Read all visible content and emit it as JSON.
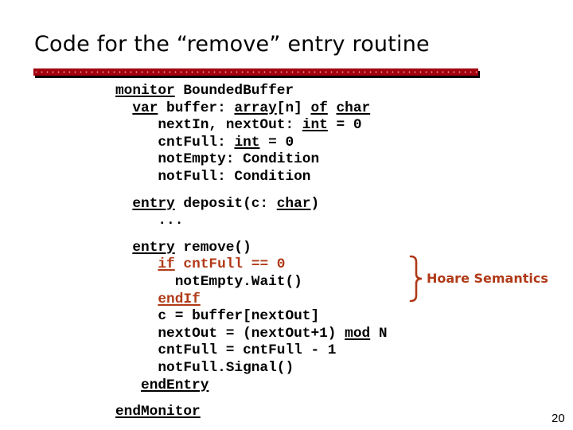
{
  "slide": {
    "title": "Code for the “remove” entry routine",
    "page_number": "20",
    "accent_color": "#a3000f",
    "highlight_color": "#b03a18"
  },
  "code": {
    "lines": [
      {
        "indent": 0,
        "parts": [
          {
            "t": "monitor",
            "kw": true
          },
          {
            "t": " BoundedBuffer"
          }
        ]
      },
      {
        "indent": 2,
        "parts": [
          {
            "t": "var",
            "kw": true
          },
          {
            "t": " buffer: "
          },
          {
            "t": "array",
            "kw": true
          },
          {
            "t": "[n] "
          },
          {
            "t": "of",
            "kw": true
          },
          {
            "t": " "
          },
          {
            "t": "char",
            "kw": true
          }
        ]
      },
      {
        "indent": 5,
        "parts": [
          {
            "t": "nextIn, nextOut: "
          },
          {
            "t": "int",
            "kw": true
          },
          {
            "t": " = 0"
          }
        ]
      },
      {
        "indent": 5,
        "parts": [
          {
            "t": "cntFull: "
          },
          {
            "t": "int",
            "kw": true
          },
          {
            "t": " = 0"
          }
        ]
      },
      {
        "indent": 5,
        "parts": [
          {
            "t": "notEmpty: Condition"
          }
        ]
      },
      {
        "indent": 5,
        "parts": [
          {
            "t": "notFull: Condition"
          }
        ]
      },
      {
        "indent": 2,
        "gap": true,
        "parts": [
          {
            "t": "entry",
            "kw": true
          },
          {
            "t": " deposit(c: "
          },
          {
            "t": "char",
            "kw": true
          },
          {
            "t": ")"
          }
        ]
      },
      {
        "indent": 5,
        "parts": [
          {
            "t": "..."
          }
        ]
      },
      {
        "indent": 2,
        "gap": true,
        "parts": [
          {
            "t": "entry",
            "kw": true
          },
          {
            "t": " remove()"
          }
        ]
      },
      {
        "indent": 5,
        "red": true,
        "parts": [
          {
            "t": "if",
            "kw": true
          },
          {
            "t": " cntFull == 0"
          }
        ]
      },
      {
        "indent": 7,
        "parts": [
          {
            "t": "notEmpty.Wait()"
          }
        ]
      },
      {
        "indent": 5,
        "red": true,
        "parts": [
          {
            "t": "endIf",
            "kw": true
          }
        ]
      },
      {
        "indent": 5,
        "parts": [
          {
            "t": "c = buffer[nextOut]"
          }
        ]
      },
      {
        "indent": 5,
        "parts": [
          {
            "t": "nextOut = (nextOut+1) "
          },
          {
            "t": "mod",
            "kw": true
          },
          {
            "t": " N"
          }
        ]
      },
      {
        "indent": 5,
        "parts": [
          {
            "t": "cntFull = cntFull - 1"
          }
        ]
      },
      {
        "indent": 5,
        "parts": [
          {
            "t": "notFull.Signal()"
          }
        ]
      },
      {
        "indent": 3,
        "parts": [
          {
            "t": "endEntry",
            "kw": true
          }
        ]
      },
      {
        "indent": 0,
        "gap": true,
        "parts": [
          {
            "t": "endMonitor",
            "kw": true
          }
        ]
      }
    ]
  },
  "annotation": {
    "label": "Hoare Semantics",
    "icon": "curly-brace-icon"
  }
}
